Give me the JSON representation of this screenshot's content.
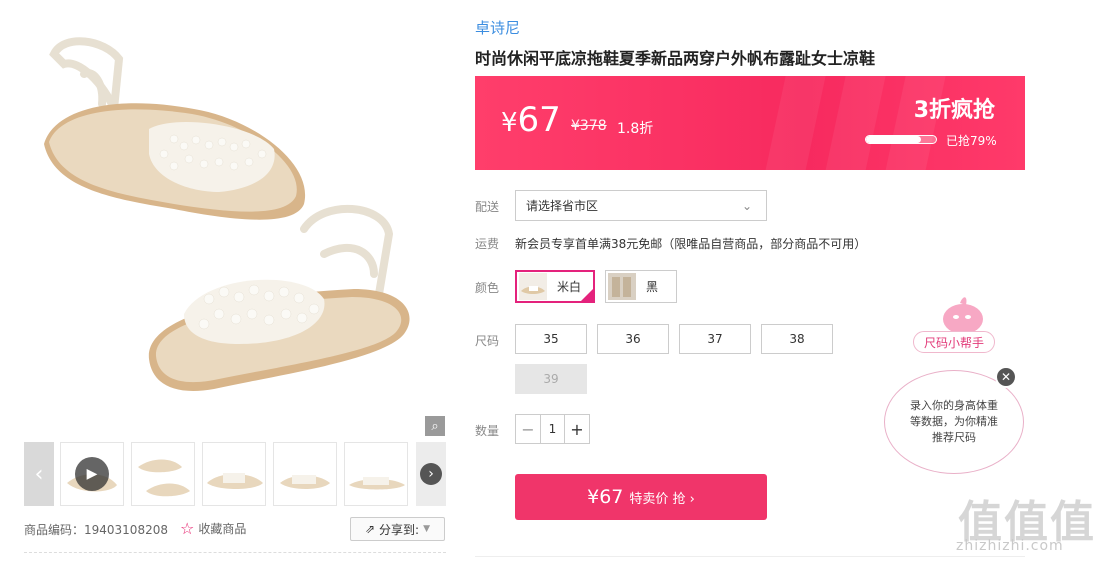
{
  "gallery": {
    "zoom_icon": "magnifier-icon",
    "thumb_count": 5
  },
  "meta": {
    "product_code": "商品编码：19403108208",
    "favorite_label": "收藏商品",
    "share_label": "分享到:"
  },
  "product": {
    "brand": "卓诗尼",
    "title": "时尚休闲平底凉拖鞋夏季新品两穿户外帆布露趾女士凉鞋"
  },
  "price_banner": {
    "currency": "¥",
    "price": "67",
    "original_price": "¥378",
    "discount": "1.8折",
    "sale_title": "3折疯抢",
    "sold_percent": 79,
    "sold_label": "已抢79%",
    "colors": {
      "start": "#ff3e6b",
      "end": "#f72a5f"
    }
  },
  "delivery": {
    "label": "配送",
    "select_value": "请选择省市区"
  },
  "shipping": {
    "label": "运费",
    "text": "新会员专享首单满38元免邮（限唯品自营商品，部分商品不可用）"
  },
  "color": {
    "label": "颜色",
    "options": [
      {
        "name": "米白",
        "selected": true
      },
      {
        "name": "黑",
        "selected": false
      }
    ],
    "accent": "#e4227c"
  },
  "size": {
    "label": "尺码",
    "options": [
      "35",
      "36",
      "37",
      "38",
      "39"
    ],
    "disabled": [
      "39"
    ]
  },
  "quantity": {
    "label": "数量",
    "minus": "−",
    "value": "1",
    "plus": "+"
  },
  "buy_button": {
    "price": "¥67",
    "text": "特卖价 抢 ›",
    "color": "#f0356a"
  },
  "helper": {
    "tag": "尺码小帮手",
    "bubble": "录入你的身高体重等数据，为你精准推荐尺码"
  },
  "watermark": {
    "big": "值值值",
    "url": "zhizhizhi.com"
  }
}
